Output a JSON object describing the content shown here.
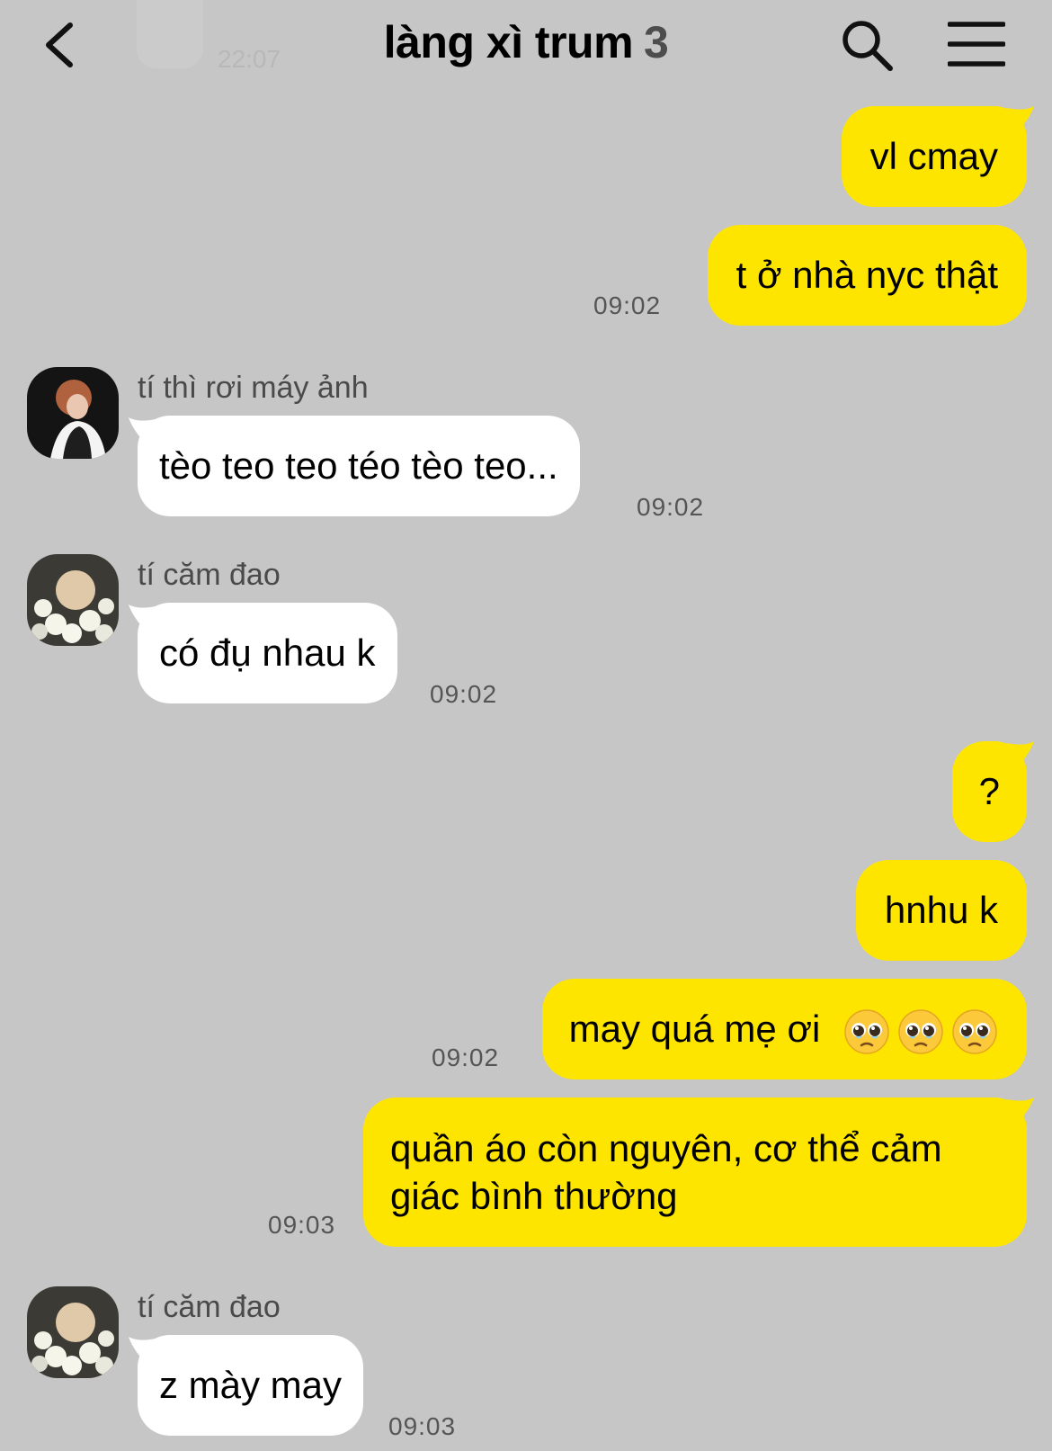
{
  "header": {
    "title": "làng xì trum",
    "member_count": "3",
    "ghost_time": "22:07"
  },
  "icons": [
    "back-arrow-icon",
    "search-icon",
    "menu-icon"
  ],
  "colors": {
    "background": "#c6c6c6",
    "my_bubble": "#fee500",
    "their_bubble": "#ffffff"
  },
  "messages": [
    {
      "side": "me",
      "text": "vl cmay"
    },
    {
      "side": "me",
      "text": "t ở nhà nyc thật",
      "time": "09:02"
    },
    {
      "side": "other",
      "sender": "tí thì rơi máy ảnh",
      "text": "tèo teo teo téo tèo teo...",
      "time": "09:02"
    },
    {
      "side": "other",
      "sender": "tí căm đao",
      "text": "có đụ nhau k",
      "time": "09:02"
    },
    {
      "side": "me",
      "text": "?"
    },
    {
      "side": "me",
      "text": "hnhu k"
    },
    {
      "side": "me",
      "text": "may quá mẹ ơi",
      "emoji": [
        "pleading-face-emoji",
        "pleading-face-emoji",
        "pleading-face-emoji"
      ],
      "time": "09:02"
    },
    {
      "side": "me",
      "text_line1": "quần áo còn nguyên, cơ thể cảm",
      "text_line2": "giác bình thường",
      "time": "09:03"
    },
    {
      "side": "other",
      "sender": "tí căm đao",
      "text": "z mày may",
      "time": "09:03"
    }
  ]
}
